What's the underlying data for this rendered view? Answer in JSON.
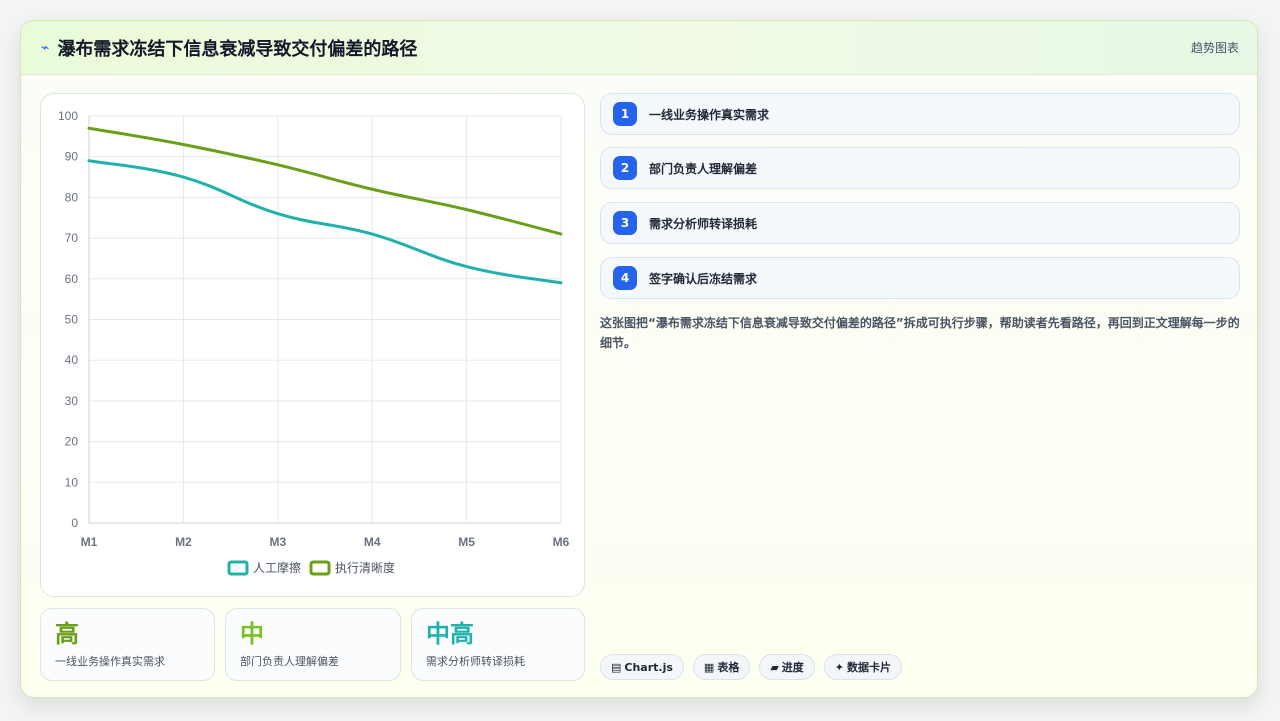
{
  "header": {
    "title": "瀑布需求冻结下信息衰减导致交付偏差的路径",
    "tag": "趋势图表"
  },
  "chart_data": {
    "type": "line",
    "categories": [
      "M1",
      "M2",
      "M3",
      "M4",
      "M5",
      "M6"
    ],
    "series": [
      {
        "name": "人工摩擦",
        "values": [
          89,
          85,
          76,
          71,
          63,
          59
        ],
        "color": "#20b2aa"
      },
      {
        "name": "执行清晰度",
        "values": [
          97,
          93,
          88,
          82,
          77,
          71
        ],
        "color": "#6a9f1a"
      }
    ],
    "ylim": [
      0,
      100
    ],
    "yticks": [
      0,
      10,
      20,
      30,
      40,
      50,
      60,
      70,
      80,
      90,
      100
    ],
    "grid": true,
    "legend": "bottom"
  },
  "stats": [
    {
      "value": "高",
      "label": "一线业务操作真实需求",
      "color": "#6a9f1a"
    },
    {
      "value": "中",
      "label": "部门负责人理解偏差",
      "color": "#7cc01f"
    },
    {
      "value": "中高",
      "label": "需求分析师转译损耗",
      "color": "#20b2aa"
    }
  ],
  "steps": [
    {
      "num": "1",
      "label": "一线业务操作真实需求"
    },
    {
      "num": "2",
      "label": "部门负责人理解偏差"
    },
    {
      "num": "3",
      "label": "需求分析师转译损耗"
    },
    {
      "num": "4",
      "label": "签字确认后冻结需求"
    }
  ],
  "description": "这张图把“瀑布需求冻结下信息衰减导致交付偏差的路径”拆成可执行步骤，帮助读者先看路径，再回到正文理解每一步的细节。",
  "chips": [
    {
      "icon": "▤",
      "icon_name": "chart-icon",
      "label": "Chart.js"
    },
    {
      "icon": "▦",
      "icon_name": "table-icon",
      "label": "表格"
    },
    {
      "icon": "▰",
      "icon_name": "progress-icon",
      "label": "进度"
    },
    {
      "icon": "✦",
      "icon_name": "sparkle-icon",
      "label": "数据卡片"
    }
  ]
}
